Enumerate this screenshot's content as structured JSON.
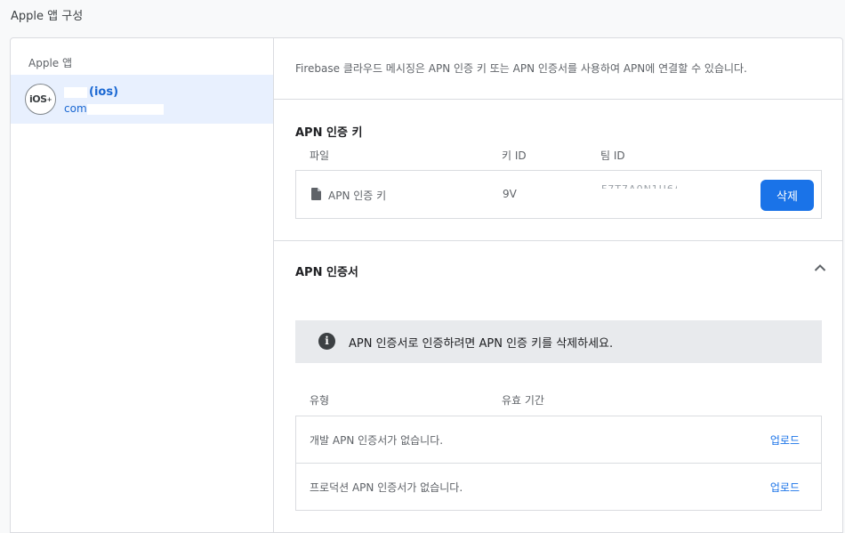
{
  "page": {
    "title": "Apple 앱 구성"
  },
  "sidebar": {
    "heading": "Apple 앱",
    "apps": [
      {
        "badge": "iOS",
        "badge_sup": "+",
        "name": "(ios)",
        "bundle": "com"
      }
    ]
  },
  "intro": {
    "text": "Firebase 클라우드 메시징은 APN 인증 키 또는 APN 인증서를 사용하여 APN에 연결할 수 있습니다."
  },
  "auth_key": {
    "title": "APN 인증 키",
    "columns": {
      "file": "파일",
      "key_id": "키 ID",
      "team_id": "팀 ID"
    },
    "row": {
      "file": "APN 인증 키",
      "key_id": "9V",
      "team_id": "F7T7A0N1U6A7"
    },
    "delete_label": "삭제"
  },
  "certificates": {
    "title": "APN 인증서",
    "info": "APN 인증서로 인증하려면 APN 인증 키를 삭제하세요.",
    "columns": {
      "type": "유형",
      "expiry": "유효 기간"
    },
    "rows": [
      {
        "text": "개발 APN 인증서가 없습니다.",
        "action": "업로드"
      },
      {
        "text": "프로덕션 APN 인증서가 없습니다.",
        "action": "업로드"
      }
    ]
  },
  "colors": {
    "accent": "#1a73e8",
    "selected_bg": "#e8f0fe",
    "banner_bg": "#e8eaed"
  },
  "icons": [
    "ios-badge-icon",
    "file-icon",
    "chevron-up-icon",
    "info-icon"
  ]
}
